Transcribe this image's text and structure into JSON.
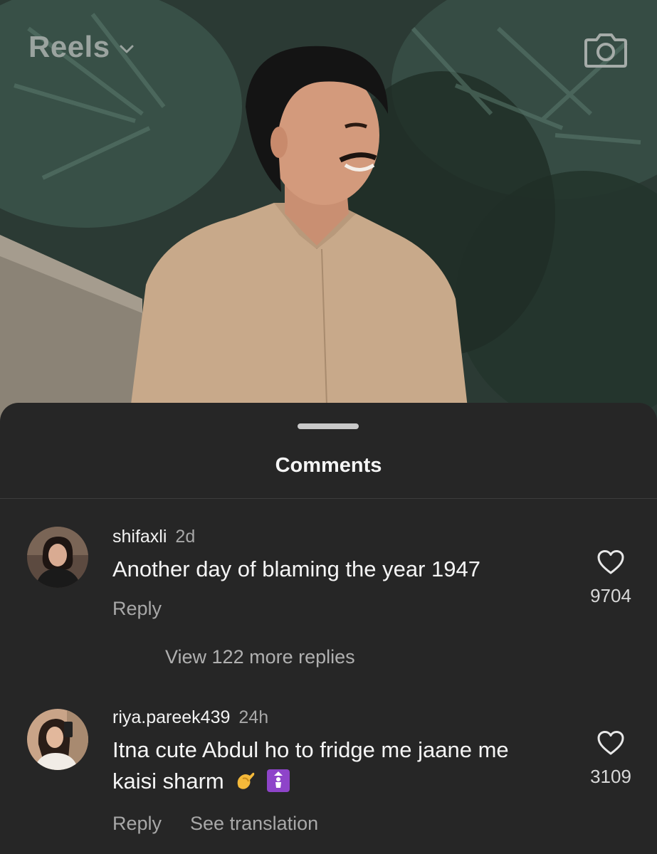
{
  "header": {
    "title": "Reels",
    "chevron_icon": "chevron-down-icon",
    "camera_icon": "camera-icon"
  },
  "comments_sheet": {
    "title": "Comments",
    "comments": [
      {
        "username": "shifaxli",
        "time": "2d",
        "text": "Another day of blaming the year 1947",
        "likes": "9704",
        "reply_label": "Reply",
        "view_replies": "View 122 more replies"
      },
      {
        "username": "riya.pareek439",
        "time": "24h",
        "text_line1": "Itna cute Abdul ho to fridge me jaane me",
        "text_line2": "kaisi sharm",
        "emojis": [
          "pinching-hand-emoji",
          "person-in-lift-emoji"
        ],
        "likes": "3109",
        "reply_label": "Reply",
        "translate_label": "See translation"
      }
    ]
  },
  "colors": {
    "sheet_background": "#262626",
    "secondary_text": "#a8a8a8",
    "primary_text": "#f5f5f5"
  }
}
